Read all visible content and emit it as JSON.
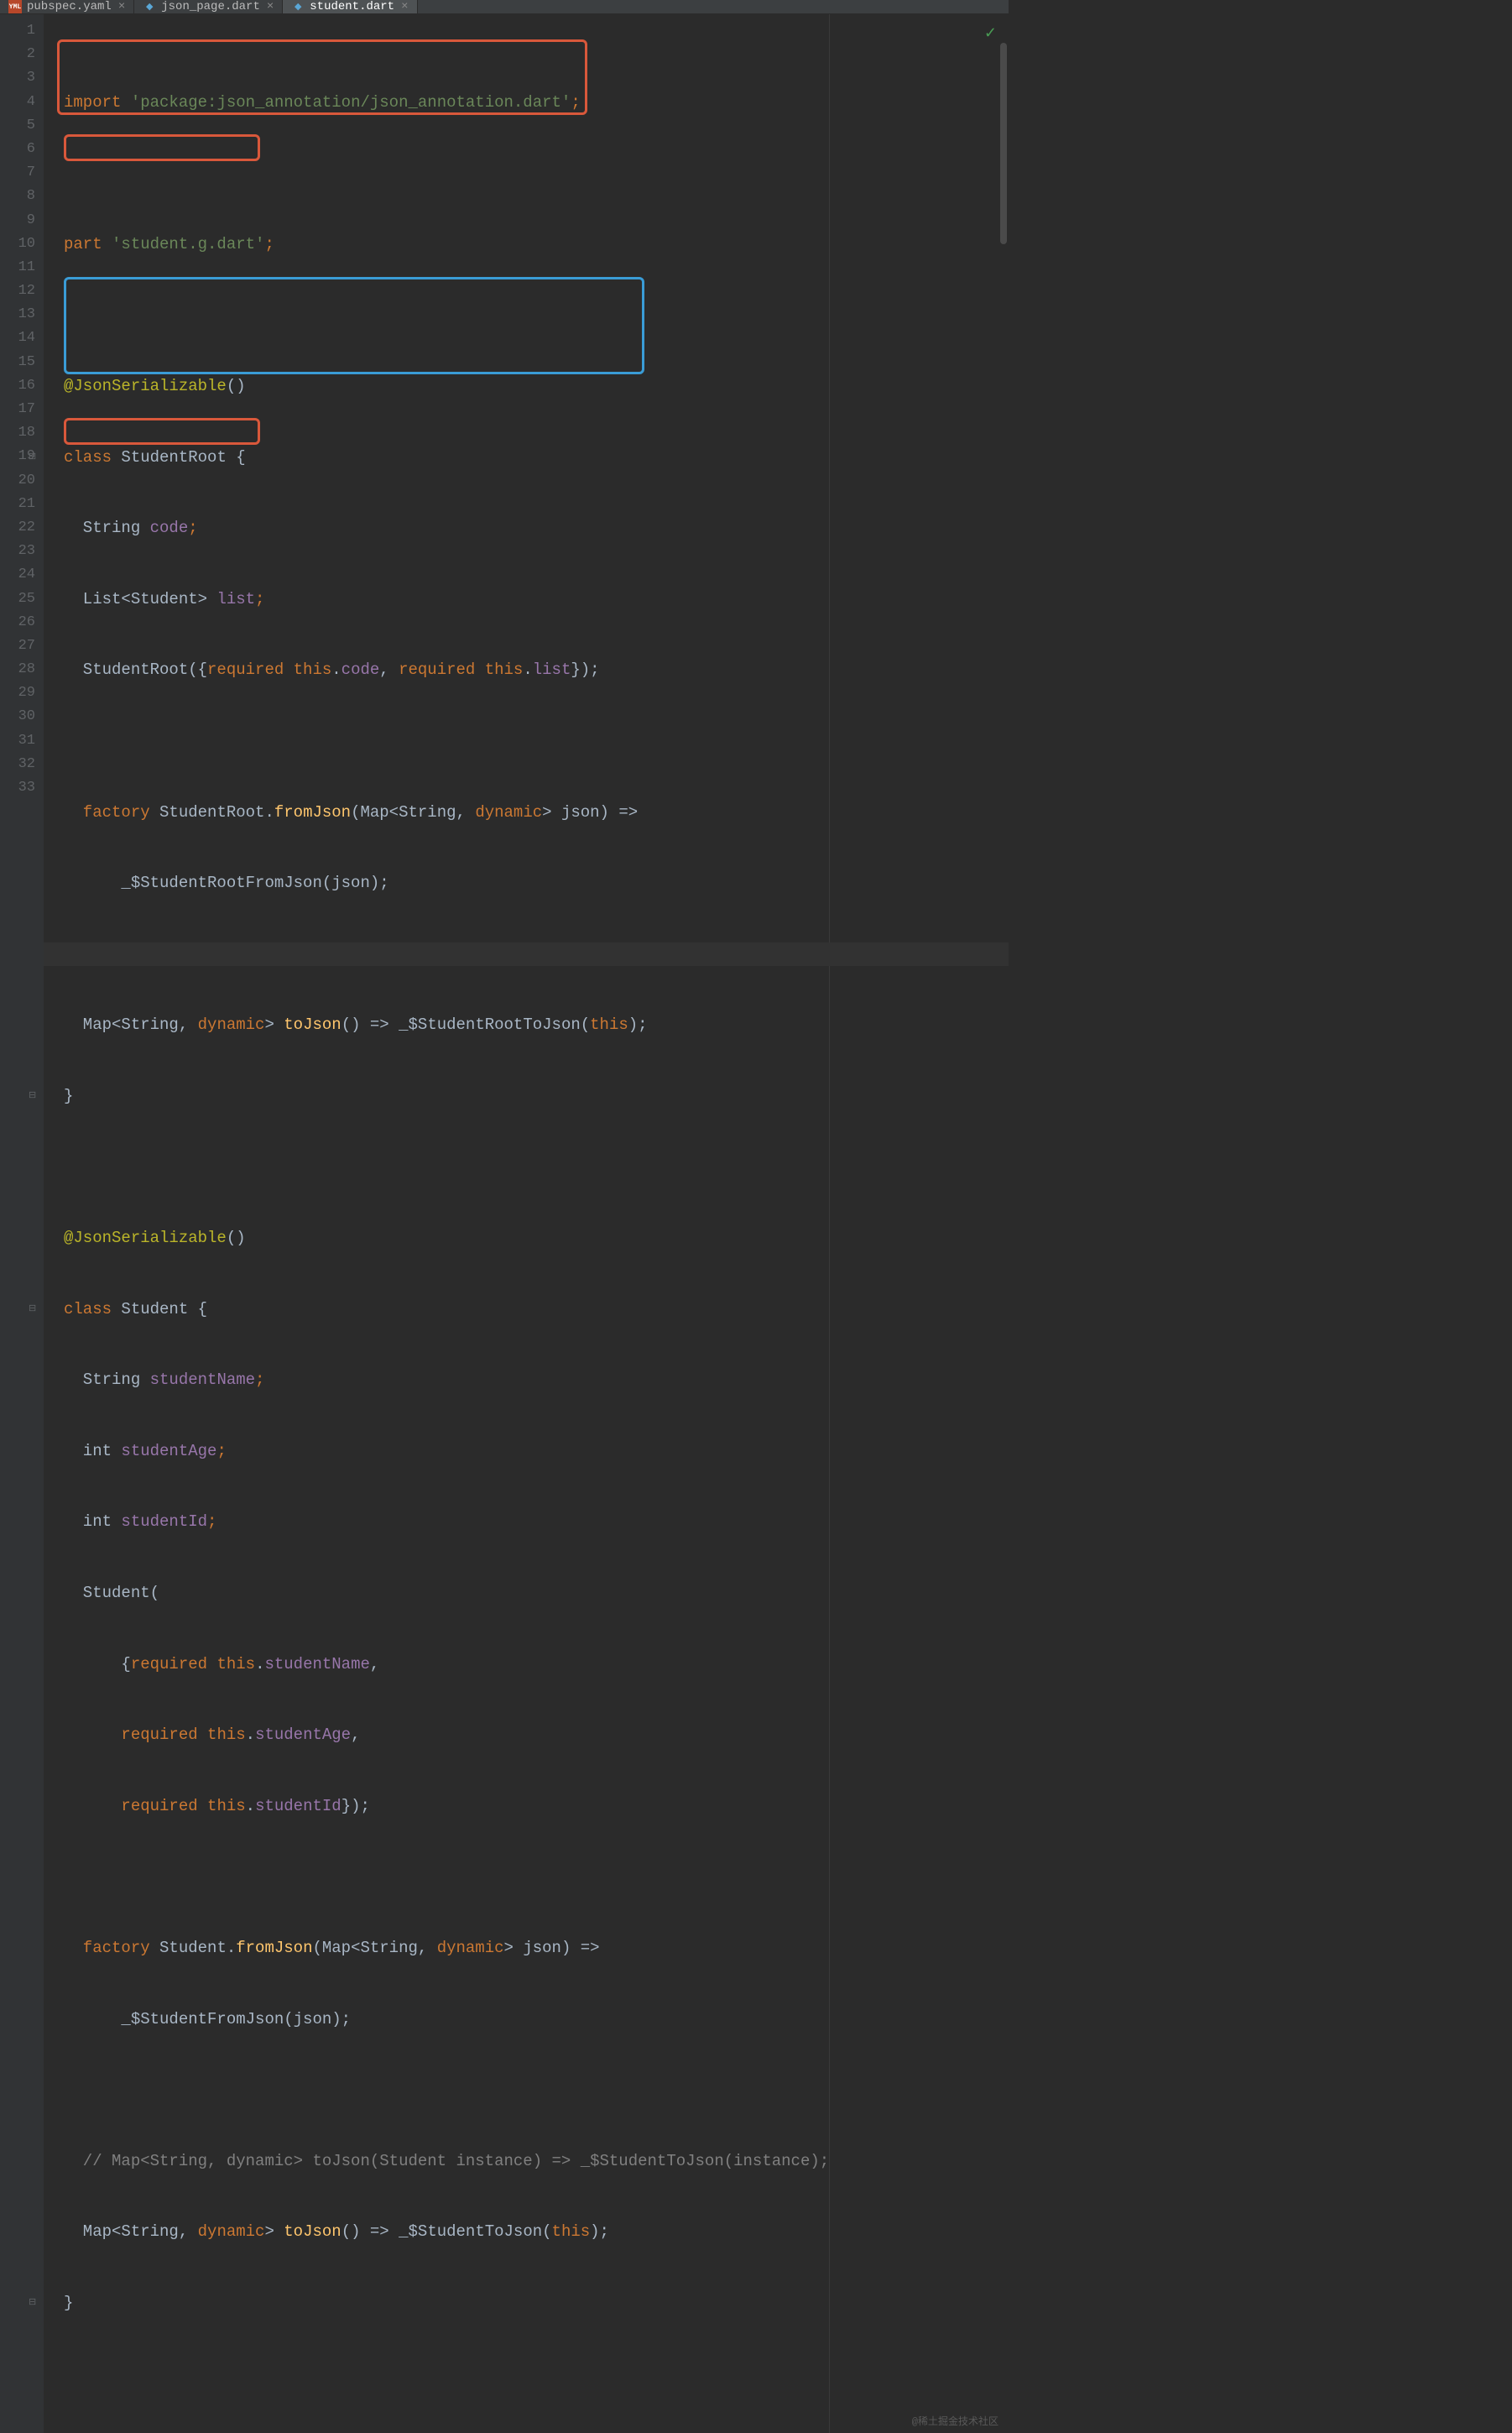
{
  "tabs": [
    {
      "icon": "YML",
      "label": "pubspec.yaml",
      "active": false
    },
    {
      "icon": "dart",
      "label": "json_page.dart",
      "active": false
    },
    {
      "icon": "dart",
      "label": "student.dart",
      "active": true
    }
  ],
  "lines": {
    "l1_import": "import ",
    "l1_str": "'package:json_annotation/json_annotation.dart'",
    "l1_end": ";",
    "l3_part": "part ",
    "l3_str": "'student.g.dart'",
    "l3_end": ";",
    "l5_ann": "@JsonSerializable",
    "l5_paren": "()",
    "l6_class": "class ",
    "l6_name": "StudentRoot {",
    "l7_type": "  String ",
    "l7_ident": "code",
    "l7_end": ";",
    "l8_type": "  List<Student> ",
    "l8_ident": "list",
    "l8_end": ";",
    "l9_ctor": "  StudentRoot({",
    "l9_req1": "required ",
    "l9_this1": "this",
    "l9_dot1": ".",
    "l9_code": "code",
    "l9_comma": ", ",
    "l9_req2": "required ",
    "l9_this2": "this",
    "l9_dot2": ".",
    "l9_list": "list",
    "l9_end": "});",
    "l11_fac": "  factory ",
    "l11_sr": "StudentRoot.",
    "l11_fn": "fromJson",
    "l11_sig1": "(Map<String, ",
    "l11_dyn": "dynamic",
    "l11_sig2": "> json) =>",
    "l12": "      _$StudentRootFromJson(json);",
    "l14_map": "  Map<String, ",
    "l14_dyn": "dynamic",
    "l14_gt": "> ",
    "l14_fn": "toJson",
    "l14_sig": "() => _$StudentRootToJson(",
    "l14_this": "this",
    "l14_end": ");",
    "l15": "}",
    "l17_ann": "@JsonSerializable",
    "l17_paren": "()",
    "l18_class": "class ",
    "l18_name": "Student {",
    "l19_type": "  String ",
    "l19_ident": "studentName",
    "l19_end": ";",
    "l20_type": "  int ",
    "l20_ident": "studentAge",
    "l20_end": ";",
    "l21_type": "  int ",
    "l21_ident": "studentId",
    "l21_end": ";",
    "l22": "  Student(",
    "l23_pad": "      {",
    "l23_req": "required ",
    "l23_this": "this",
    "l23_dot": ".",
    "l23_id": "studentName",
    "l23_end": ",",
    "l24_pad": "      ",
    "l24_req": "required ",
    "l24_this": "this",
    "l24_dot": ".",
    "l24_id": "studentAge",
    "l24_end": ",",
    "l25_pad": "      ",
    "l25_req": "required ",
    "l25_this": "this",
    "l25_dot": ".",
    "l25_id": "studentId",
    "l25_end": "});",
    "l27_fac": "  factory ",
    "l27_st": "Student.",
    "l27_fn": "fromJson",
    "l27_sig1": "(Map<String, ",
    "l27_dyn": "dynamic",
    "l27_sig2": "> json) =>",
    "l28": "      _$StudentFromJson(json);",
    "l30_cmt": "  // Map<String, dynamic> toJson(Student instance) => _$StudentToJson(instance);",
    "l31_map": "  Map<String, ",
    "l31_dyn": "dynamic",
    "l31_gt": "> ",
    "l31_fn": "toJson",
    "l31_sig": "() => _$StudentToJson(",
    "l31_this": "this",
    "l31_end": ");",
    "l32": "}"
  },
  "gutter": [
    "1",
    "2",
    "3",
    "4",
    "5",
    "6",
    "7",
    "8",
    "9",
    "10",
    "11",
    "12",
    "13",
    "14",
    "15",
    "16",
    "17",
    "18",
    "19",
    "20",
    "21",
    "22",
    "23",
    "24",
    "25",
    "26",
    "27",
    "28",
    "29",
    "30",
    "31",
    "32",
    "33"
  ],
  "checkmark": "✓",
  "watermark": "@稀土掘金技术社区"
}
